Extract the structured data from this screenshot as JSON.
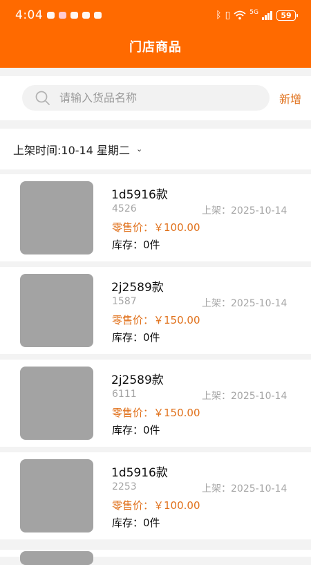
{
  "status_bar": {
    "time": "4:04",
    "signal_text": "5G",
    "battery": "59"
  },
  "header": {
    "title": "门店商品"
  },
  "search": {
    "placeholder": "请输入货品名称",
    "add_label": "新增"
  },
  "filter": {
    "label": "上架时间:10-14 星期二"
  },
  "products": [
    {
      "name": "1d5916款",
      "code": "4526",
      "shelf_date": "上架：2025-10-14",
      "price": "零售价：￥100.00",
      "stock": "库存：0件"
    },
    {
      "name": "2j2589款",
      "code": "1587",
      "shelf_date": "上架：2025-10-14",
      "price": "零售价：￥150.00",
      "stock": "库存：0件"
    },
    {
      "name": "2j2589款",
      "code": "6111",
      "shelf_date": "上架：2025-10-14",
      "price": "零售价：￥150.00",
      "stock": "库存：0件"
    },
    {
      "name": "1d5916款",
      "code": "2253",
      "shelf_date": "上架：2025-10-14",
      "price": "零售价：￥100.00",
      "stock": "库存：0件"
    }
  ],
  "colors": {
    "brand": "#ff6a00",
    "accent_text": "#e0701a",
    "thumb_placeholder": "#a3a3a3"
  },
  "icons": {
    "search": "search-icon",
    "dropdown": "chevron-down-icon",
    "bluetooth": "bluetooth-icon",
    "vibrate": "vibrate-icon",
    "wifi": "wifi-icon",
    "cell": "cellular-signal-icon",
    "battery": "battery-icon"
  }
}
